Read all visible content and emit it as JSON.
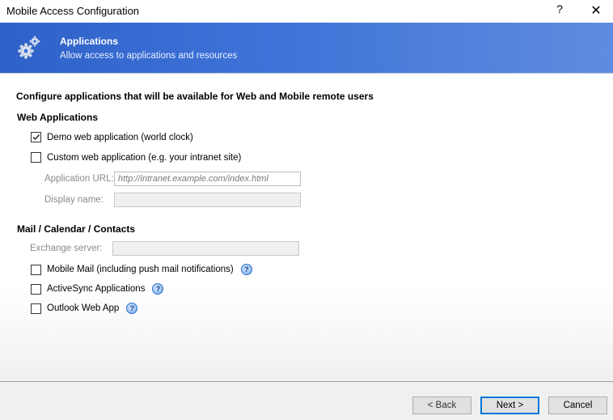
{
  "window": {
    "title": "Mobile Access Configuration",
    "help_label": "?",
    "close_label": "✕"
  },
  "header": {
    "icon": "gears-icon",
    "title": "Applications",
    "subtitle": "Allow access to applications and resources"
  },
  "intro": "Configure applications that will be available for Web and Mobile remote users",
  "web_apps": {
    "heading": "Web Applications",
    "demo": {
      "label": "Demo web application (world clock)",
      "checked": true
    },
    "custom": {
      "label": "Custom web application (e.g. your intranet site)",
      "checked": false
    },
    "url_label": "Application URL:",
    "url_placeholder": "http://intranet.example.com/index.html",
    "display_label": "Display name:",
    "display_value": ""
  },
  "mail": {
    "heading": "Mail / Calendar / Contacts",
    "exchange_label": "Exchange server:",
    "exchange_value": "",
    "mobile_mail": {
      "label": "Mobile Mail (including push mail notifications)",
      "checked": false
    },
    "activesync": {
      "label": "ActiveSync Applications",
      "checked": false
    },
    "owa": {
      "label": "Outlook Web App",
      "checked": false
    },
    "help_glyph": "?"
  },
  "buttons": {
    "back": "< Back",
    "next": "Next >",
    "cancel": "Cancel"
  },
  "colors": {
    "banner_start": "#2f62c9",
    "banner_end": "#5f8cde",
    "focus_border": "#0078d7"
  }
}
